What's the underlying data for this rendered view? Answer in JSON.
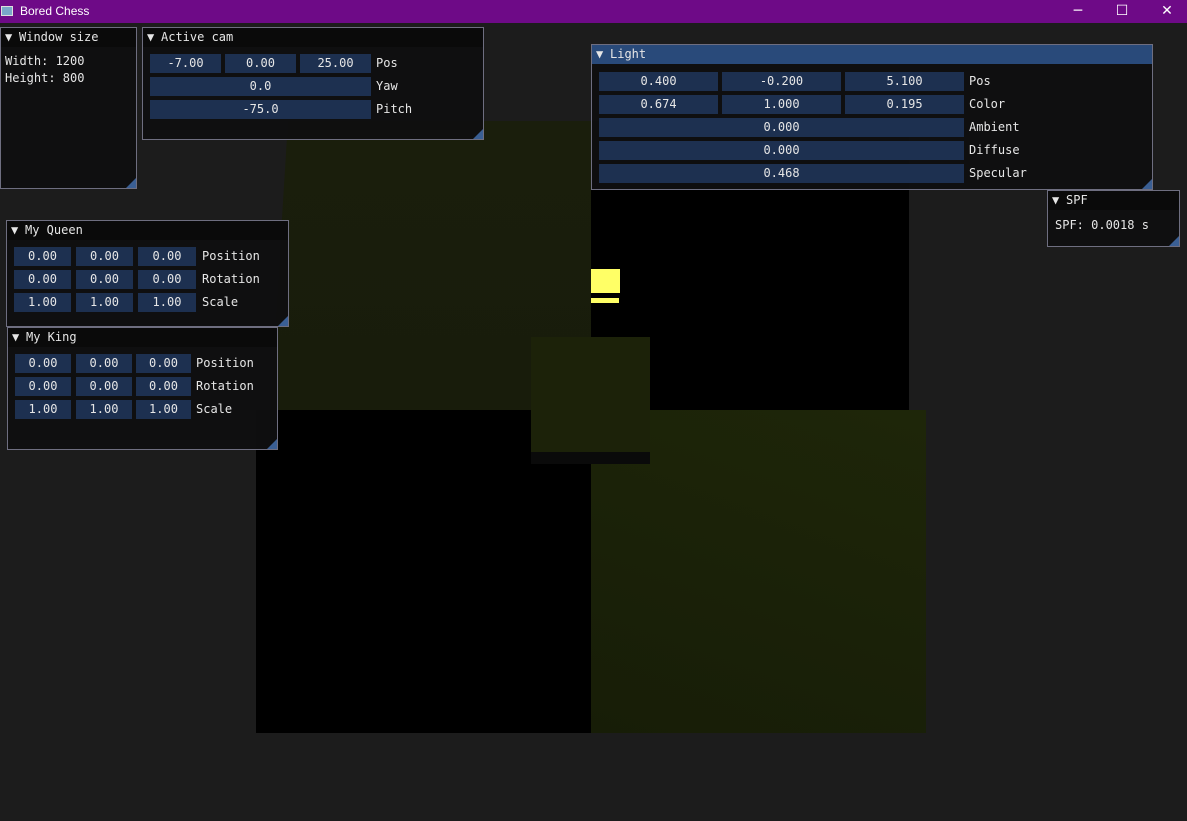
{
  "window": {
    "title": "Bored Chess",
    "icon": "app-window-icon",
    "controls": {
      "minimize": "─",
      "maximize": "☐",
      "close": "✕"
    },
    "titlebar_color": "#6e0a87"
  },
  "panels": {
    "window_size": {
      "title": "Window size",
      "width_text": "Width: 1200",
      "height_text": "Height: 800"
    },
    "active_cam": {
      "title": "Active cam",
      "pos": [
        "-7.00",
        "0.00",
        "25.00"
      ],
      "pos_label": "Pos",
      "yaw": "0.0",
      "yaw_label": "Yaw",
      "pitch": "-75.0",
      "pitch_label": "Pitch"
    },
    "light": {
      "title": "Light",
      "pos": [
        "0.400",
        "-0.200",
        "5.100"
      ],
      "pos_label": "Pos",
      "color": [
        "0.674",
        "1.000",
        "0.195"
      ],
      "color_label": "Color",
      "ambient": "0.000",
      "ambient_label": "Ambient",
      "diffuse": "0.000",
      "diffuse_label": "Diffuse",
      "specular": "0.468",
      "specular_label": "Specular"
    },
    "spf": {
      "title": "SPF",
      "text": "SPF: 0.0018 s"
    },
    "my_queen": {
      "title": "My Queen",
      "position": [
        "0.00",
        "0.00",
        "0.00"
      ],
      "position_label": "Position",
      "rotation": [
        "0.00",
        "0.00",
        "0.00"
      ],
      "rotation_label": "Rotation",
      "scale": [
        "1.00",
        "1.00",
        "1.00"
      ],
      "scale_label": "Scale"
    },
    "my_king": {
      "title": "My King",
      "position": [
        "0.00",
        "0.00",
        "0.00"
      ],
      "position_label": "Position",
      "rotation": [
        "0.00",
        "0.00",
        "0.00"
      ],
      "rotation_label": "Rotation",
      "scale": [
        "1.00",
        "1.00",
        "1.00"
      ],
      "scale_label": "Scale"
    }
  },
  "colors": {
    "panel_title_active": "#294a7a",
    "field_bg": "#1d3050",
    "light_cube": "#ffff66",
    "dark_square": "#1b2108",
    "background": "#1c1c1c"
  }
}
